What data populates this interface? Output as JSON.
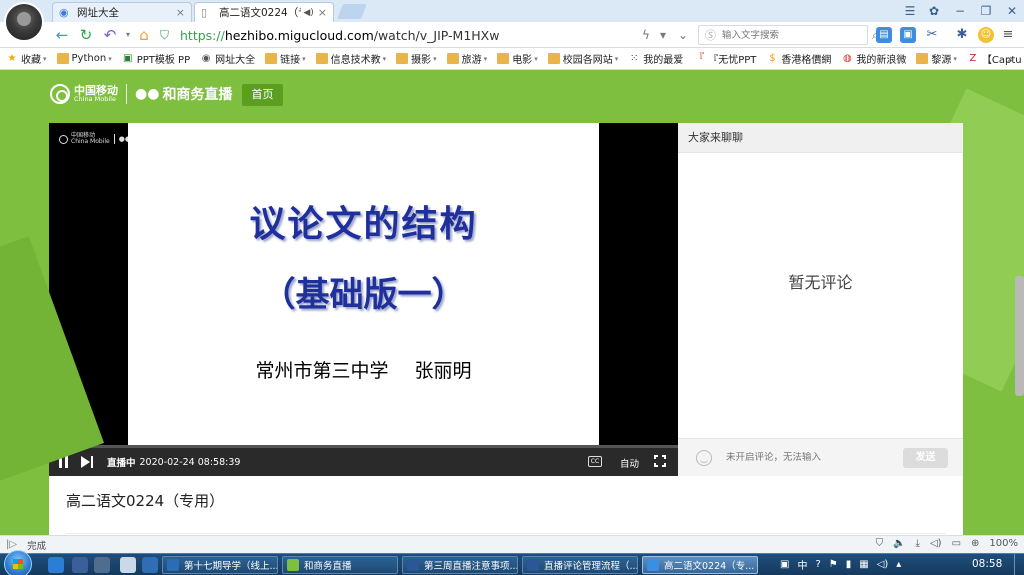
{
  "browser": {
    "tabs": [
      {
        "label": "网址大全",
        "close": "×"
      },
      {
        "label": "高二语文0224（专用",
        "close": "×"
      }
    ],
    "window_controls": {
      "skin": "✿",
      "menu": "☰",
      "minimize": "−",
      "restore": "❐",
      "close": "✕"
    },
    "url": {
      "scheme": "https://",
      "host": "hezhibo.migucloud.com",
      "path": "/watch/v_JIP-M1HXw"
    },
    "search_placeholder": "输入文字搜索",
    "bookmarks": [
      {
        "label": "收藏",
        "icon": "star-icon",
        "caret": true
      },
      {
        "label": "Python",
        "icon": "folder-icon",
        "caret": true
      },
      {
        "label": "PPT模板 PP",
        "icon": "ppt-icon",
        "caret": false
      },
      {
        "label": "网址大全",
        "icon": "globe-icon",
        "caret": false
      },
      {
        "label": "链接",
        "icon": "folder-icon",
        "caret": true
      },
      {
        "label": "信息技术教",
        "icon": "folder-icon",
        "caret": true
      },
      {
        "label": "摄影",
        "icon": "folder-icon",
        "caret": true
      },
      {
        "label": "旅游",
        "icon": "folder-icon",
        "caret": true
      },
      {
        "label": "电影",
        "icon": "folder-icon",
        "caret": true
      },
      {
        "label": "校园各网站",
        "icon": "folder-icon",
        "caret": true
      },
      {
        "label": "我的最爱",
        "icon": "grid-icon",
        "caret": false
      },
      {
        "label": "『无忧PPT",
        "icon": "ppt-red-icon",
        "caret": false
      },
      {
        "label": "香港格價網",
        "icon": "coin-icon",
        "caret": false
      },
      {
        "label": "我的新浪微",
        "icon": "weibo-icon",
        "caret": false
      },
      {
        "label": "黎源",
        "icon": "folder-icon",
        "caret": true
      },
      {
        "label": "【Captu",
        "icon": "z-icon",
        "caret": false
      }
    ],
    "bookmarks_more": "»",
    "status_text": "完成",
    "zoom": "100%"
  },
  "site": {
    "brand_cm_line1": "中国移动",
    "brand_cm_line2": "China Mobile",
    "brand_name": "和商务直播",
    "nav_home": "首页"
  },
  "player": {
    "slide_title": "议论文的结构",
    "slide_subtitle": "（基础版一）",
    "slide_author": "常州市第三中学 张丽明",
    "watermark_line1": "中国移动",
    "watermark_line2": "China Mobile",
    "status": "直播中",
    "datetime": "2020-02-24 08:58:39",
    "subtitle_btn": "CC",
    "quality": "自动",
    "progress": 0.015
  },
  "chat": {
    "header": "大家来聊聊",
    "empty_text": "暂无评论",
    "input_placeholder": "未开启评论，无法输入",
    "send_label": "发送"
  },
  "video_title": "高二语文0224（专用）",
  "taskbar": {
    "tasks": [
      {
        "label": "第十七期导学（线上...",
        "color": "#2b6db5"
      },
      {
        "label": "和商务直播",
        "color": "#7fbf3f"
      },
      {
        "label": "第三周直播注意事项...",
        "color": "#2b5797"
      },
      {
        "label": "直播评论管理流程（...",
        "color": "#2b5797"
      },
      {
        "label": "高二语文0224（专...",
        "color": "#3b8ee0"
      }
    ],
    "ime": "中",
    "clock": "08:58"
  },
  "colors": {
    "page_bg": "#7fbf3f",
    "home_btn": "#5b9e22",
    "slide_text": "#1f2f9c",
    "progress": "#3a8ee6"
  }
}
